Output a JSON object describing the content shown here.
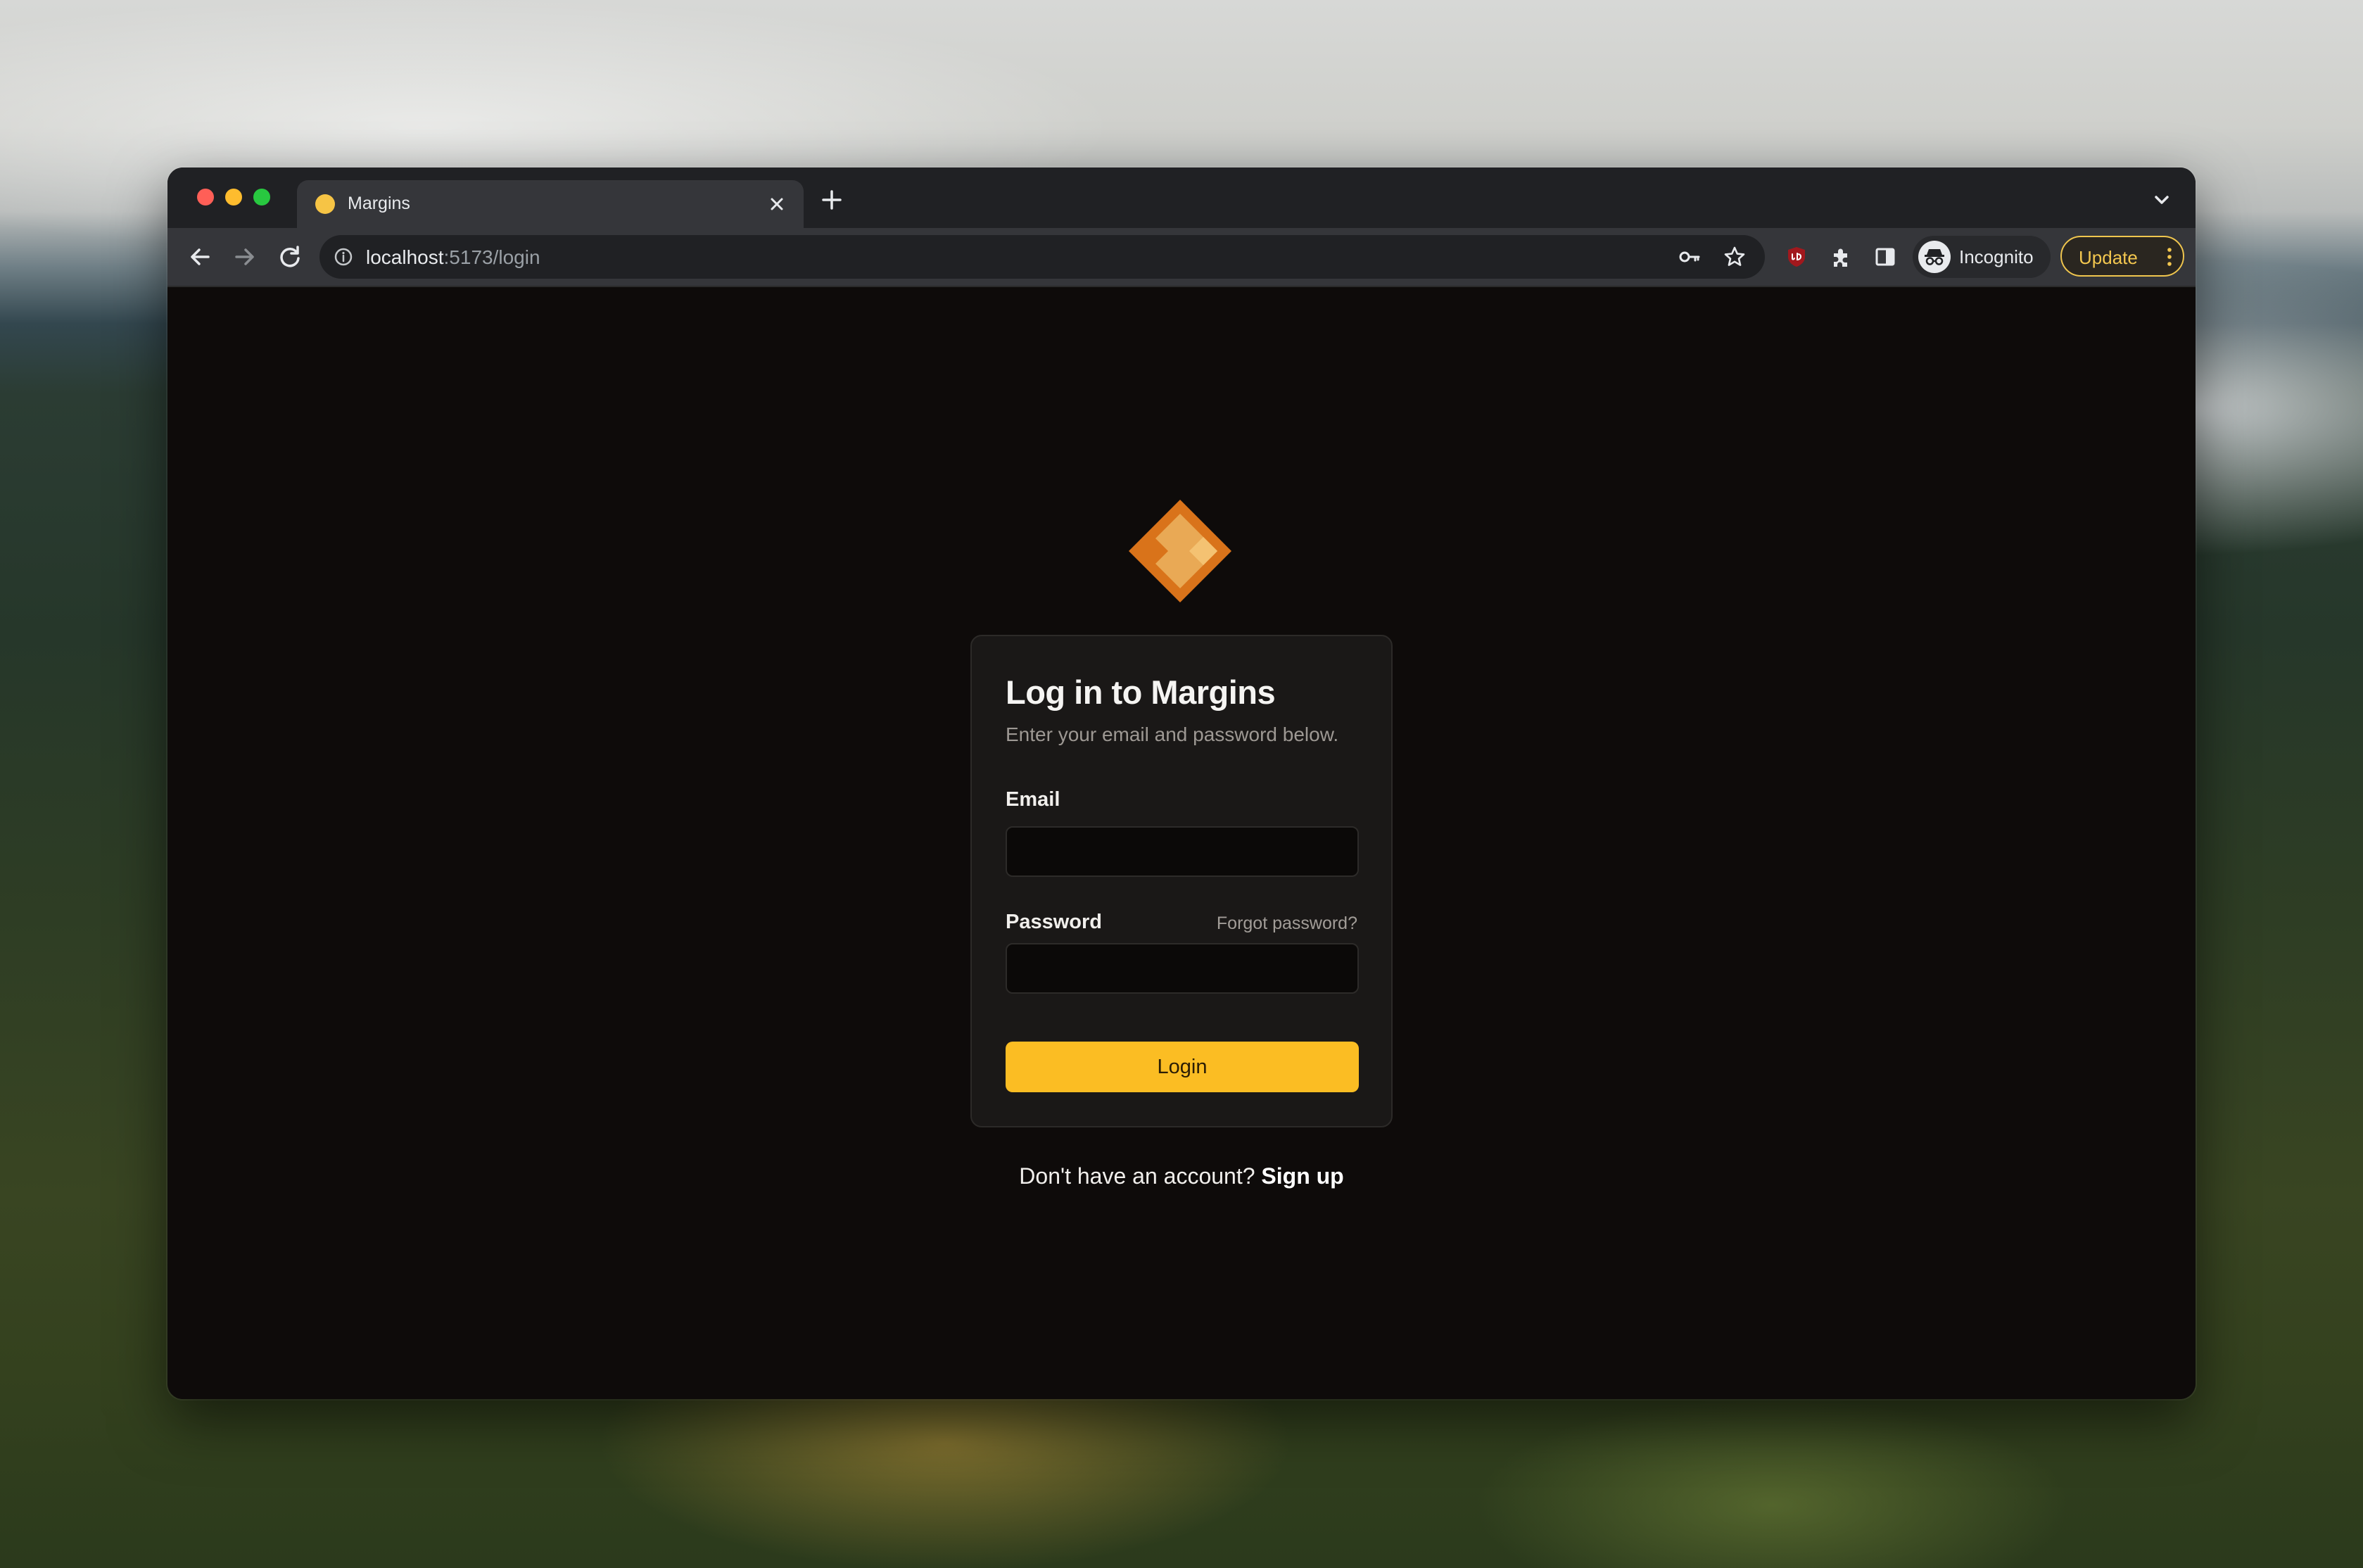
{
  "browser": {
    "tab": {
      "title": "Margins",
      "favicon": "margins-favicon",
      "close_icon": "close-icon"
    },
    "new_tab_icon": "plus-icon",
    "tab_search_icon": "chevron-down-icon",
    "nav": {
      "back_icon": "arrow-left-icon",
      "forward_icon": "arrow-right-icon",
      "reload_icon": "reload-icon"
    },
    "omnibox": {
      "site_info_icon": "info-icon",
      "url_host": "localhost",
      "url_path": ":5173/login",
      "key_icon": "key-icon",
      "bookmark_icon": "star-icon"
    },
    "extensions": [
      "ublock-origin-icon",
      "puzzle-icon",
      "side-panel-icon"
    ],
    "profile": {
      "label": "Incognito",
      "icon": "incognito-icon"
    },
    "update": {
      "label": "Update",
      "menu_icon": "kebab-menu-icon"
    }
  },
  "login": {
    "logo": "margins-logo",
    "title": "Log in to Margins",
    "subtitle": "Enter your email and password below.",
    "email_label": "Email",
    "email_value": "",
    "password_label": "Password",
    "password_value": "",
    "forgot_password": "Forgot password?",
    "login_button": "Login",
    "signup_prompt": "Don't have an account?",
    "signup_link": "Sign up"
  },
  "colors": {
    "accent": "#fbbd23",
    "page_background": "#0e0b0a",
    "card_background": "#1a1817",
    "logo_dark_orange": "#d9731a",
    "logo_light_orange": "#f4c272"
  }
}
